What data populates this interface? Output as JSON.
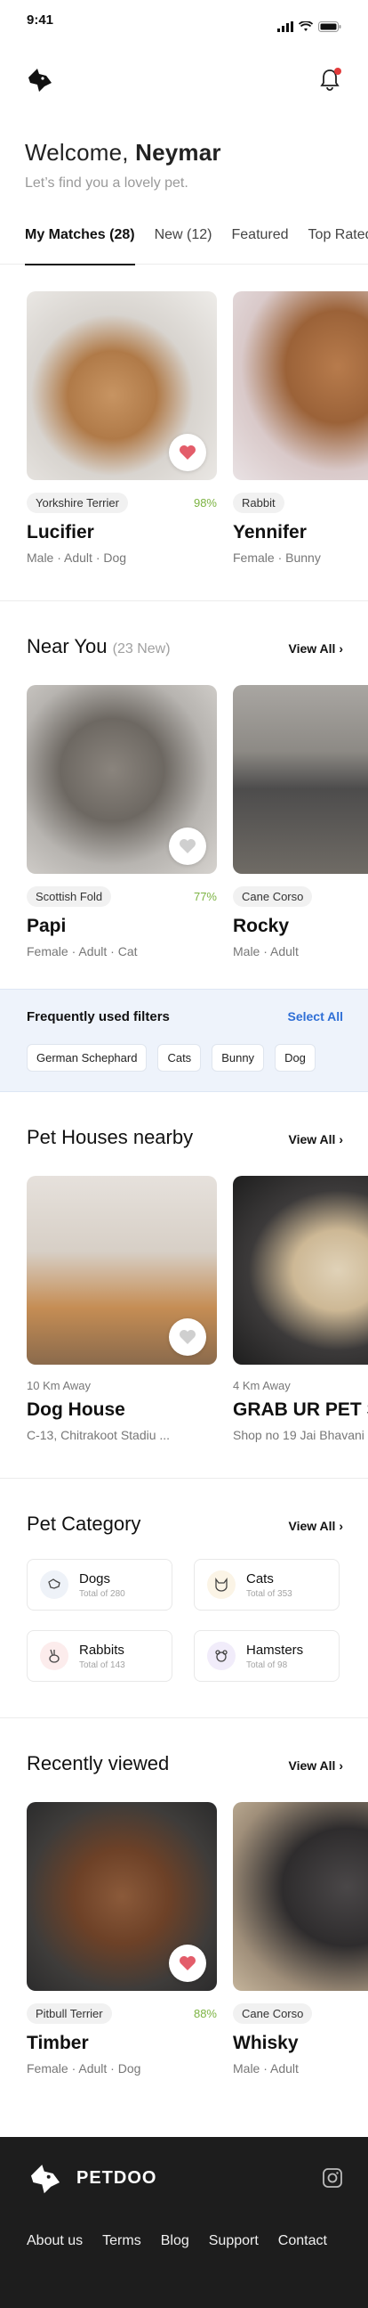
{
  "status_bar": {
    "time": "9:41"
  },
  "welcome": {
    "greeting": "Welcome, ",
    "name": "Neymar",
    "subtitle": "Let’s find you a lovely pet."
  },
  "tabs": [
    {
      "label": "My Matches (28)"
    },
    {
      "label": "New (12)"
    },
    {
      "label": "Featured"
    },
    {
      "label": "Top Rated"
    }
  ],
  "matches": [
    {
      "breed": "Yorkshire Terrier",
      "match": "98%",
      "name": "Lucifier",
      "details": "Male · Adult · Dog"
    },
    {
      "breed": "Rabbit",
      "match": "",
      "name": "Yennifer",
      "details": "Female · Bunny"
    }
  ],
  "near_you": {
    "title": "Near You",
    "count": "(23 New)",
    "view_all": "View All",
    "pets": [
      {
        "breed": "Scottish Fold",
        "match": "77%",
        "name": "Papi",
        "details": "Female · Adult · Cat"
      },
      {
        "breed": "Cane Corso",
        "match": "",
        "name": "Rocky",
        "details": "Male · Adult"
      }
    ]
  },
  "filters": {
    "title": "Frequently used  filters",
    "select_all": "Select All",
    "chips": [
      "German Schephard",
      "Cats",
      "Bunny",
      "Dog"
    ]
  },
  "pet_houses": {
    "title": "Pet Houses nearby",
    "view_all": "View All",
    "items": [
      {
        "distance": "10 Km Away",
        "name": "Dog House",
        "address": "C-13, Chitrakoot Stadiu ..."
      },
      {
        "distance": "4 Km Away",
        "name": "GRAB UR PET SHOP",
        "address": "Shop no 19 Jai Bhavani"
      }
    ]
  },
  "category": {
    "title": "Pet Category",
    "view_all": "View All",
    "items": [
      {
        "name": "Dogs",
        "total": "Total of 280",
        "color": "#eef2f8"
      },
      {
        "name": "Cats",
        "total": "Total of 353",
        "color": "#fbf4e6"
      },
      {
        "name": "Rabbits",
        "total": "Total of 143",
        "color": "#fcecec"
      },
      {
        "name": "Hamsters",
        "total": "Total of 98",
        "color": "#f1ecfa"
      }
    ]
  },
  "recent": {
    "title": "Recently viewed",
    "view_all": "View All",
    "pets": [
      {
        "breed": "Pitbull Terrier",
        "match": "88%",
        "name": "Timber",
        "details": "Female · Adult · Dog"
      },
      {
        "breed": "Cane Corso",
        "match": "",
        "name": "Whisky",
        "details": "Male · Adult"
      }
    ]
  },
  "footer": {
    "brand": "PETDOO",
    "links": [
      "About us",
      "Terms",
      "Blog",
      "Support",
      "Contact"
    ]
  },
  "colors": {
    "heart": "#e35d6a",
    "match_green": "#7cb342",
    "accent_blue": "#2f6fd6",
    "footer_bg": "#1d1d1d"
  }
}
